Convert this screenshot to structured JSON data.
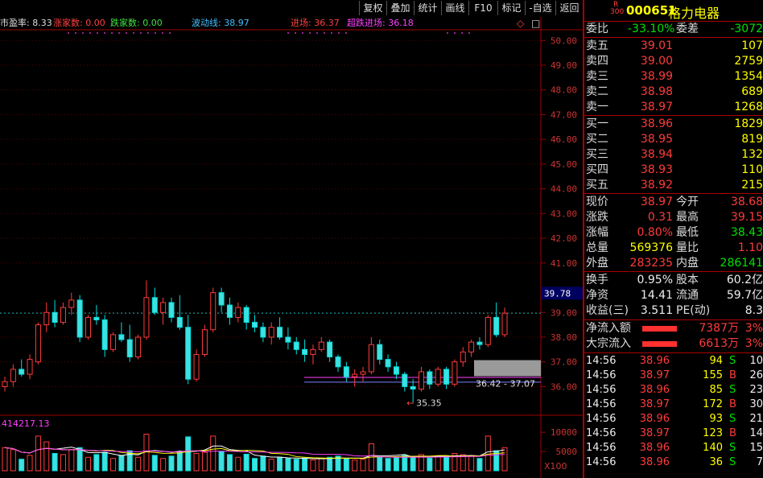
{
  "toolbar": {
    "buttons": [
      "复权",
      "叠加",
      "统计",
      "画线",
      "F10",
      "标记",
      "-自选",
      "返回"
    ]
  },
  "indicators": {
    "pe_label": "市盈率: 8.33",
    "up_label": "涨家数: 0.00",
    "down_label": "跌家数: 0.00",
    "wave_label": "波动线: 38.97",
    "entry_label": "进场: 36.37",
    "super_entry_label": "超跌进场: 36.18"
  },
  "price_axis": {
    "ticks": [
      "50.00",
      "49.00",
      "48.00",
      "47.00",
      "46.00",
      "45.00",
      "44.00",
      "43.00",
      "42.00",
      "41.00",
      "39.00",
      "38.00",
      "37.00",
      "36.00"
    ],
    "current_price_tag": "39.78",
    "range_label": "36.42 - 37.07",
    "low_marker": "35.35"
  },
  "volume": {
    "label": "414217.13",
    "ticks": [
      "10000",
      "5000"
    ],
    "unit": "X100"
  },
  "stock": {
    "badge_top": "R",
    "badge_bottom": "300",
    "code": "000651",
    "name": "格力电器"
  },
  "order_book": {
    "weibi_label": "委比",
    "weibi_value": "-33.10%",
    "weicha_label": "委差",
    "weicha_value": "-3072",
    "asks": [
      {
        "label": "卖五",
        "price": "39.01",
        "qty": "107"
      },
      {
        "label": "卖四",
        "price": "39.00",
        "qty": "2759"
      },
      {
        "label": "卖三",
        "price": "38.99",
        "qty": "1354"
      },
      {
        "label": "卖二",
        "price": "38.98",
        "qty": "689"
      },
      {
        "label": "卖一",
        "price": "38.97",
        "qty": "1268"
      }
    ],
    "bids": [
      {
        "label": "买一",
        "price": "38.96",
        "qty": "1829"
      },
      {
        "label": "买二",
        "price": "38.95",
        "qty": "819"
      },
      {
        "label": "买三",
        "price": "38.94",
        "qty": "132"
      },
      {
        "label": "买四",
        "price": "38.93",
        "qty": "110"
      },
      {
        "label": "买五",
        "price": "38.92",
        "qty": "215"
      }
    ]
  },
  "quote": {
    "rows": [
      {
        "l1": "现价",
        "v1": "38.97",
        "c1": "red",
        "l2": "今开",
        "v2": "38.68",
        "c2": "red"
      },
      {
        "l1": "涨跌",
        "v1": "0.31",
        "c1": "red",
        "l2": "最高",
        "v2": "39.15",
        "c2": "red"
      },
      {
        "l1": "涨幅",
        "v1": "0.80%",
        "c1": "red",
        "l2": "最低",
        "v2": "38.43",
        "c2": "green"
      },
      {
        "l1": "总量",
        "v1": "569376",
        "c1": "yellow",
        "l2": "量比",
        "v2": "1.10",
        "c2": "red"
      },
      {
        "l1": "外盘",
        "v1": "283235",
        "c1": "red",
        "l2": "内盘",
        "v2": "286141",
        "c2": "green"
      }
    ]
  },
  "fundamentals": {
    "rows": [
      {
        "l1": "换手",
        "v1": "0.95%",
        "l2": "股本",
        "v2": "60.2亿"
      },
      {
        "l1": "净资",
        "v1": "14.41",
        "l2": "流通",
        "v2": "59.7亿"
      },
      {
        "l1": "收益(三)",
        "v1": "3.511",
        "l2": "PE(动)",
        "v2": "8.3"
      }
    ]
  },
  "flows": {
    "rows": [
      {
        "label": "净流入额",
        "value": "7387万",
        "pct": "3%",
        "bar_fraction": 0.6
      },
      {
        "label": "大宗流入",
        "value": "6613万",
        "pct": "3%",
        "bar_fraction": 0.6
      }
    ]
  },
  "ticks": [
    {
      "time": "14:56",
      "price": "38.96",
      "pc": "red",
      "vol": "94",
      "side": "S",
      "sc": "green",
      "n": "10"
    },
    {
      "time": "14:56",
      "price": "38.97",
      "pc": "red",
      "vol": "155",
      "side": "B",
      "sc": "red",
      "n": "26"
    },
    {
      "time": "14:56",
      "price": "38.96",
      "pc": "red",
      "vol": "85",
      "side": "S",
      "sc": "green",
      "n": "23"
    },
    {
      "time": "14:56",
      "price": "38.97",
      "pc": "red",
      "vol": "172",
      "side": "B",
      "sc": "red",
      "n": "30"
    },
    {
      "time": "14:56",
      "price": "38.96",
      "pc": "red",
      "vol": "93",
      "side": "S",
      "sc": "green",
      "n": "21"
    },
    {
      "time": "14:56",
      "price": "38.97",
      "pc": "red",
      "vol": "123",
      "side": "B",
      "sc": "red",
      "n": "14"
    },
    {
      "time": "14:56",
      "price": "38.96",
      "pc": "red",
      "vol": "140",
      "side": "S",
      "sc": "green",
      "n": "15"
    },
    {
      "time": "14:56",
      "price": "38.96",
      "pc": "red",
      "vol": "36",
      "side": "S",
      "sc": "green",
      "n": "7"
    }
  ],
  "colors": {
    "up": "#ff3b3b",
    "down": "#00e0e0",
    "down_fill": "#40e0e0",
    "background": "#000000",
    "grid": "#a00000"
  },
  "chart_data": {
    "type": "candlestick",
    "y_range": [
      35.2,
      50.4
    ],
    "ohlc": [
      [
        36.0,
        36.4,
        35.8,
        36.2
      ],
      [
        36.2,
        36.9,
        36.0,
        36.7
      ],
      [
        36.7,
        37.1,
        36.4,
        36.5
      ],
      [
        36.5,
        37.3,
        36.3,
        37.1
      ],
      [
        37.0,
        38.6,
        36.9,
        38.5
      ],
      [
        38.5,
        39.4,
        38.2,
        39.0
      ],
      [
        39.0,
        39.5,
        38.4,
        38.6
      ],
      [
        38.6,
        39.4,
        38.5,
        39.2
      ],
      [
        39.2,
        39.8,
        38.9,
        39.5
      ],
      [
        39.5,
        39.7,
        37.8,
        38.0
      ],
      [
        38.0,
        38.9,
        37.9,
        38.8
      ],
      [
        38.8,
        39.3,
        38.5,
        38.7
      ],
      [
        38.7,
        38.9,
        37.2,
        37.5
      ],
      [
        37.5,
        38.2,
        37.4,
        38.1
      ],
      [
        38.1,
        38.6,
        37.8,
        37.9
      ],
      [
        37.9,
        38.5,
        37.0,
        37.2
      ],
      [
        37.2,
        38.1,
        37.1,
        38.0
      ],
      [
        38.0,
        40.3,
        37.9,
        39.6
      ],
      [
        39.6,
        40.0,
        38.9,
        39.0
      ],
      [
        39.0,
        39.6,
        38.5,
        39.4
      ],
      [
        39.4,
        39.6,
        38.6,
        38.8
      ],
      [
        38.8,
        39.7,
        38.3,
        38.4
      ],
      [
        38.4,
        38.9,
        36.1,
        36.3
      ],
      [
        36.3,
        37.5,
        36.2,
        37.3
      ],
      [
        37.3,
        38.5,
        37.2,
        38.3
      ],
      [
        38.3,
        40.0,
        38.2,
        39.8
      ],
      [
        39.8,
        40.0,
        39.0,
        39.3
      ],
      [
        39.3,
        39.6,
        38.5,
        38.8
      ],
      [
        38.8,
        39.4,
        38.6,
        39.2
      ],
      [
        39.2,
        39.3,
        38.3,
        38.6
      ],
      [
        38.6,
        38.9,
        38.2,
        38.4
      ],
      [
        38.4,
        38.6,
        37.8,
        38.0
      ],
      [
        38.0,
        38.6,
        37.7,
        38.4
      ],
      [
        38.4,
        38.8,
        37.9,
        38.0
      ],
      [
        38.0,
        38.4,
        37.5,
        37.8
      ],
      [
        37.8,
        38.0,
        37.3,
        37.5
      ],
      [
        37.5,
        37.9,
        37.0,
        37.3
      ],
      [
        37.3,
        37.7,
        36.9,
        37.5
      ],
      [
        37.5,
        38.0,
        37.4,
        37.8
      ],
      [
        37.8,
        37.9,
        37.0,
        37.2
      ],
      [
        37.2,
        37.3,
        36.6,
        36.8
      ],
      [
        36.8,
        37.0,
        36.2,
        36.4
      ],
      [
        36.4,
        36.7,
        36.0,
        36.5
      ],
      [
        36.5,
        36.8,
        36.2,
        36.6
      ],
      [
        36.6,
        38.0,
        36.5,
        37.7
      ],
      [
        37.7,
        37.9,
        36.9,
        37.1
      ],
      [
        37.1,
        37.3,
        36.6,
        36.8
      ],
      [
        36.8,
        37.0,
        36.3,
        36.5
      ],
      [
        36.5,
        36.6,
        35.8,
        36.0
      ],
      [
        36.0,
        36.3,
        35.35,
        35.9
      ],
      [
        35.9,
        36.8,
        35.8,
        36.6
      ],
      [
        36.6,
        36.7,
        35.9,
        36.1
      ],
      [
        36.1,
        36.8,
        36.0,
        36.7
      ],
      [
        36.7,
        36.8,
        35.9,
        36.1
      ],
      [
        36.1,
        37.1,
        36.0,
        37.0
      ],
      [
        37.0,
        37.6,
        36.8,
        37.4
      ],
      [
        37.4,
        37.9,
        37.2,
        37.8
      ],
      [
        37.8,
        38.0,
        37.5,
        37.7
      ],
      [
        37.7,
        38.9,
        37.6,
        38.8
      ],
      [
        38.8,
        39.4,
        38.0,
        38.1
      ],
      [
        38.1,
        39.2,
        38.0,
        38.97
      ]
    ],
    "volume": [
      6000,
      5500,
      3000,
      4000,
      9000,
      7500,
      4500,
      4200,
      5500,
      6000,
      3500,
      4200,
      4800,
      3200,
      4000,
      5200,
      3500,
      9500,
      4000,
      3200,
      3800,
      5000,
      8800,
      4500,
      4800,
      9000,
      5000,
      4200,
      3500,
      4300,
      3200,
      3800,
      3000,
      3500,
      3200,
      3000,
      3300,
      2800,
      3200,
      3500,
      3800,
      3200,
      2800,
      3000,
      7000,
      3500,
      3200,
      3400,
      4000,
      3600,
      4200,
      3300,
      3900,
      3500,
      4500,
      4200,
      3800,
      3200,
      9000,
      5200,
      6000
    ]
  }
}
